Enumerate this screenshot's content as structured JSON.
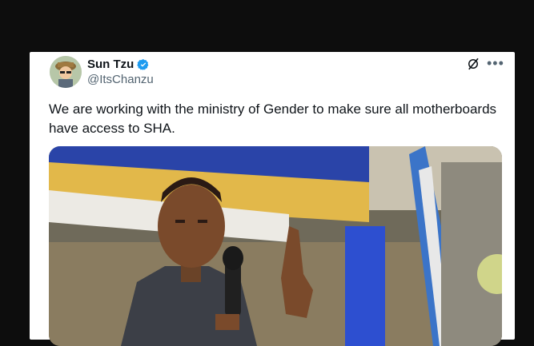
{
  "tweet": {
    "author_name": "Sun Tzu",
    "handle": "@ItsChanzu",
    "text": "We are working with the ministry of Gender to make sure all motherboards have access to SHA.",
    "verified_color": "#1d9bf0"
  },
  "icons": {
    "verified": "verified-badge-icon",
    "grok": "grok-icon",
    "more": "more-icon"
  }
}
